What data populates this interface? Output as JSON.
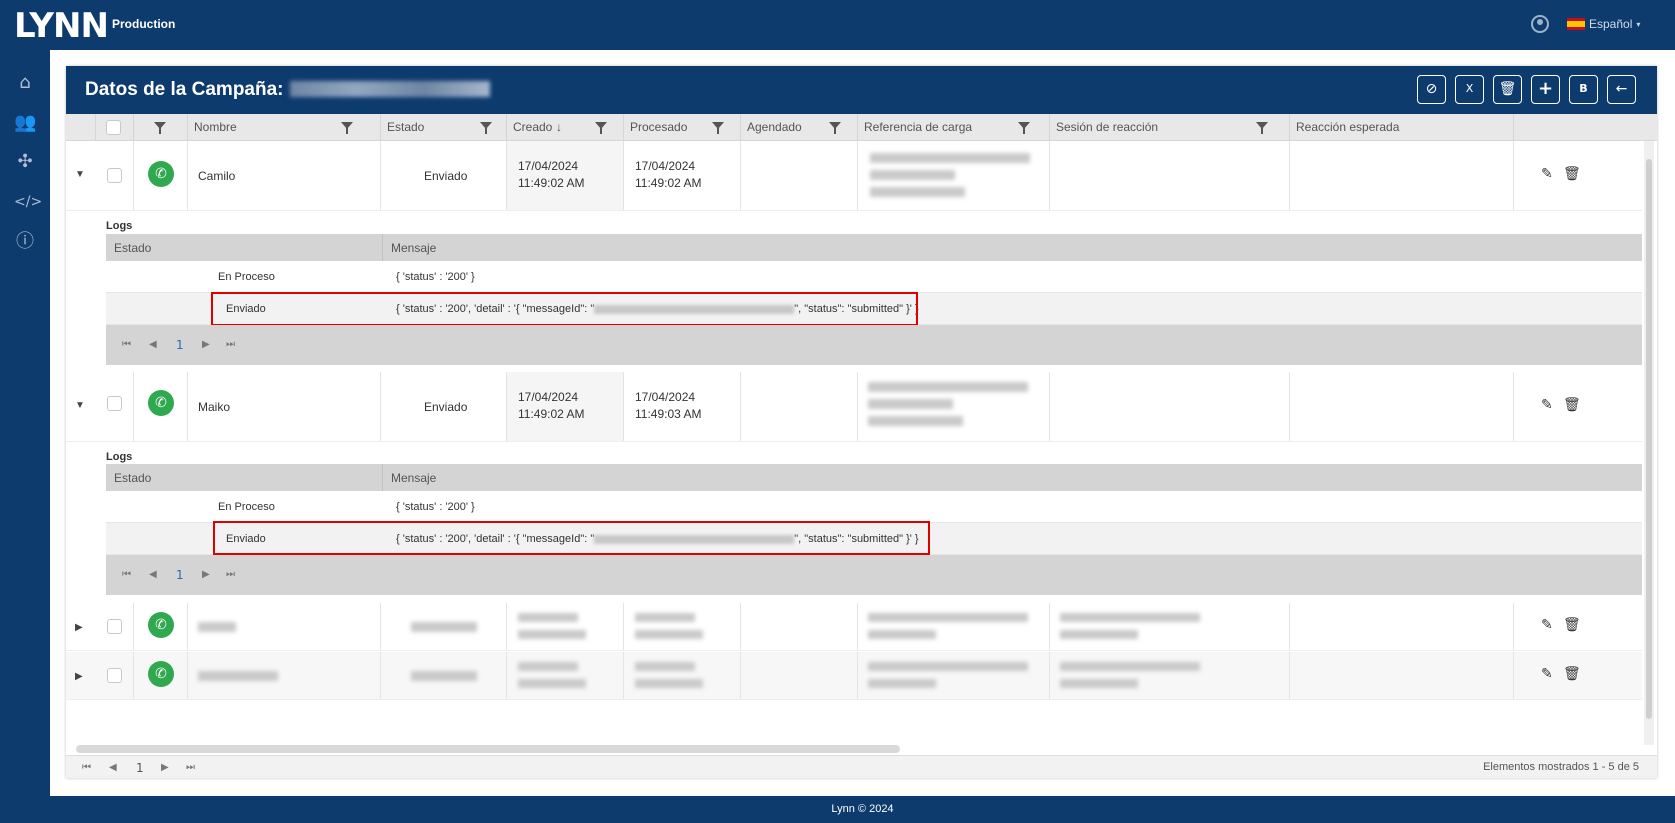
{
  "app": {
    "logo": "LYNN",
    "environment": "Production",
    "language": "Español"
  },
  "nav": {
    "icons": [
      "home-icon",
      "users-icon",
      "flow-icon",
      "code-icon",
      "info-icon"
    ]
  },
  "card": {
    "title": "Datos de la Campaña:",
    "toolbar": [
      "clear-filter-icon",
      "excel-export-icon",
      "delete-icon",
      "add-icon",
      "save-icon",
      "back-icon"
    ]
  },
  "columns": {
    "nombre": "Nombre",
    "estado": "Estado",
    "creado": "Creado",
    "procesado": "Procesado",
    "agendado": "Agendado",
    "referencia": "Referencia de carga",
    "sesion": "Sesión de reacción",
    "reaccion": "Reacción esperada"
  },
  "rows": [
    {
      "nombre": "Camilo",
      "estado": "Enviado",
      "creado_date": "17/04/2024",
      "creado_time": "11:49:02 AM",
      "procesado_date": "17/04/2024",
      "procesado_time": "11:49:02 AM",
      "logs": {
        "title": "Logs",
        "col_estado": "Estado",
        "col_mensaje": "Mensaje",
        "entries": [
          {
            "estado": "En Proceso",
            "mensaje": "{ 'status' : '200' }"
          },
          {
            "estado": "Enviado",
            "mensaje_pre": "{ 'status' : '200', 'detail' : '{ \"messageId\": \"",
            "mensaje_post": "\", \"status\": \"submitted\" }' }"
          }
        ],
        "page": "1"
      }
    },
    {
      "nombre": "Maiko",
      "estado": "Enviado",
      "creado_date": "17/04/2024",
      "creado_time": "11:49:02 AM",
      "procesado_date": "17/04/2024",
      "procesado_time": "11:49:03 AM",
      "logs": {
        "title": "Logs",
        "col_estado": "Estado",
        "col_mensaje": "Mensaje",
        "entries": [
          {
            "estado": "En Proceso",
            "mensaje": "{ 'status' : '200' }"
          },
          {
            "estado": "Enviado",
            "mensaje_pre": "{ 'status' : '200', 'detail' : '{ \"messageId\": \"",
            "mensaje_post": "\", \"status\": \"submitted\" }' }"
          }
        ],
        "page": "1"
      }
    }
  ],
  "pager": {
    "page": "1",
    "summary": "Elementos mostrados 1 - 5 de 5"
  },
  "footer": "Lynn © 2024"
}
